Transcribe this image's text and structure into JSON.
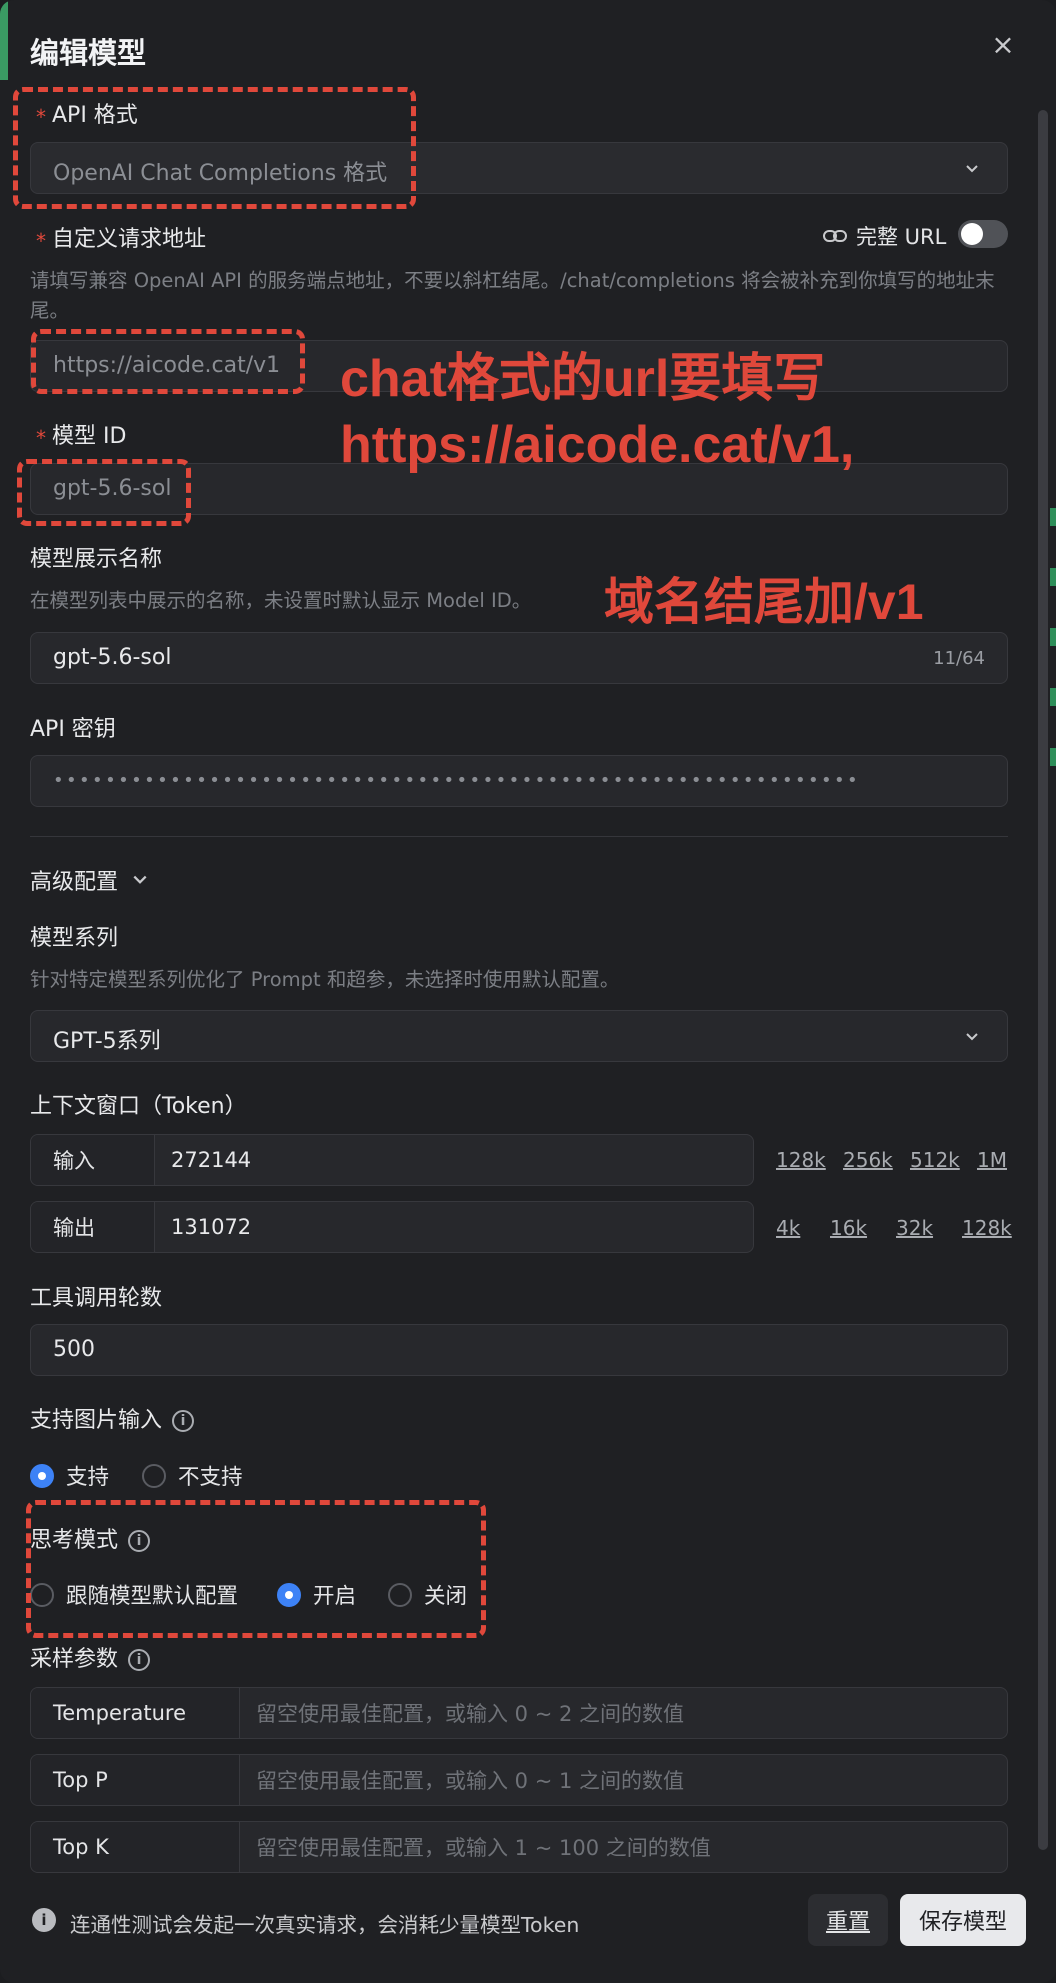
{
  "dialog": {
    "title": "编辑模型",
    "close_icon": "×"
  },
  "api_format": {
    "label": "API 格式",
    "value": "OpenAI Chat Completions 格式"
  },
  "custom_url": {
    "label": "自定义请求地址",
    "full_url_label": "完整 URL",
    "help": "请填写兼容 OpenAI API 的服务端点地址，不要以斜杠结尾。/chat/completions 将会被补充到你填写的地址末尾。",
    "value": "https://aicode.cat/v1"
  },
  "model_id": {
    "label": "模型 ID",
    "value": "gpt-5.6-sol"
  },
  "display_name": {
    "label": "模型展示名称",
    "help": "在模型列表中展示的名称，未设置时默认显示 Model ID。",
    "value": "gpt-5.6-sol",
    "count": "11/64"
  },
  "api_key": {
    "label": "API 密钥",
    "value": "••••••••••••••••••••••••••••••••••••••••••••••••••••••••••••••"
  },
  "advanced": {
    "label": "高级配置"
  },
  "model_series": {
    "label": "模型系列",
    "help": "针对特定模型系列优化了 Prompt 和超参，未选择时使用默认配置。",
    "value": "GPT-5系列"
  },
  "context": {
    "label": "上下文窗口（Token）",
    "input_label": "输入",
    "input_value": "272144",
    "input_chips": [
      "128k",
      "256k",
      "512k",
      "1M"
    ],
    "output_label": "输出",
    "output_value": "131072",
    "output_chips": [
      "4k",
      "16k",
      "32k",
      "128k"
    ]
  },
  "tool_rounds": {
    "label": "工具调用轮数",
    "value": "500"
  },
  "image_input": {
    "label": "支持图片输入",
    "options": [
      "支持",
      "不支持"
    ],
    "selected": 0
  },
  "thinking": {
    "label": "思考模式",
    "options": [
      "跟随模型默认配置",
      "开启",
      "关闭"
    ],
    "selected": 1
  },
  "sampling": {
    "label": "采样参数",
    "rows": [
      {
        "name": "Temperature",
        "placeholder": "留空使用最佳配置，或输入 0 ~ 2 之间的数值"
      },
      {
        "name": "Top P",
        "placeholder": "留空使用最佳配置，或输入 0 ~ 1 之间的数值"
      },
      {
        "name": "Top K",
        "placeholder": "留空使用最佳配置，或输入 1 ~ 100 之间的数值"
      }
    ]
  },
  "footer": {
    "note": "连通性测试会发起一次真实请求，会消耗少量模型Token",
    "reset": "重置",
    "save": "保存模型"
  },
  "annotations": {
    "line1": "chat格式的url要填写",
    "line2": "https://aicode.cat/v1,",
    "line3": "域名结尾加/v1"
  },
  "colors": {
    "accent": "#3d82f6",
    "annotation": "#e0483b",
    "background": "#1f2023"
  }
}
